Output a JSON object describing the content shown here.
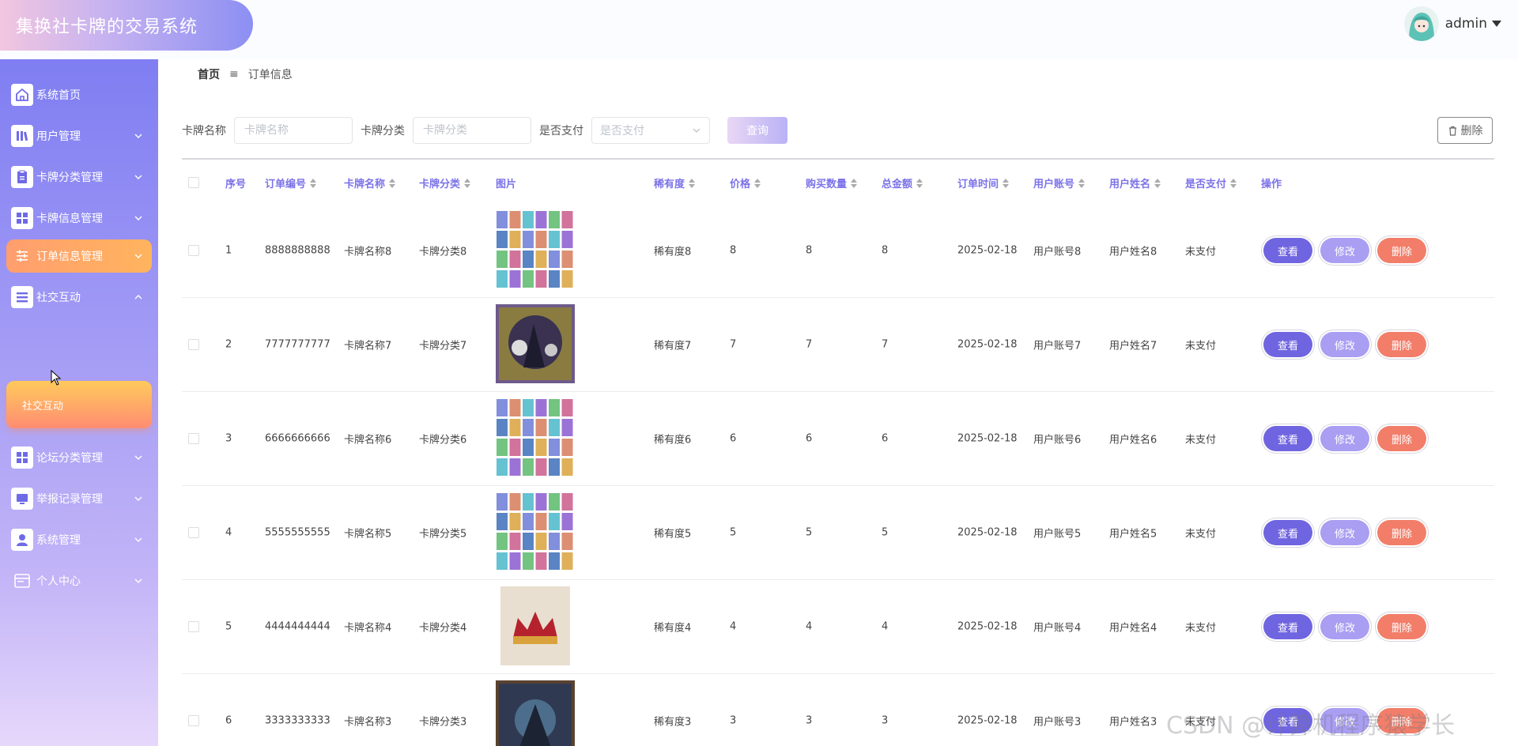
{
  "app": {
    "title": "集换社卡牌的交易系统"
  },
  "user": {
    "name": "admin"
  },
  "sidebar": {
    "items": [
      {
        "label": "系统首页",
        "icon": "home-icon",
        "has_children": false
      },
      {
        "label": "用户管理",
        "icon": "books-icon",
        "has_children": true
      },
      {
        "label": "卡牌分类管理",
        "icon": "clipboard-icon",
        "has_children": true
      },
      {
        "label": "卡牌信息管理",
        "icon": "grid-icon",
        "has_children": true
      },
      {
        "label": "订单信息管理",
        "icon": "sliders-icon",
        "has_children": true,
        "active": true
      },
      {
        "label": "社交互动",
        "icon": "list-icon",
        "has_children": true,
        "expanded": true
      },
      {
        "label": "论坛分类管理",
        "icon": "grid-icon",
        "has_children": true
      },
      {
        "label": "举报记录管理",
        "icon": "monitor-icon",
        "has_children": true
      },
      {
        "label": "系统管理",
        "icon": "person-icon",
        "has_children": true
      },
      {
        "label": "个人中心",
        "icon": "window-icon",
        "has_children": true
      }
    ],
    "submenu": {
      "label": "社交互动"
    }
  },
  "breadcrumb": {
    "home": "首页",
    "separator": "≡",
    "current": "订单信息"
  },
  "filters": {
    "card_name_label": "卡牌名称",
    "card_name_placeholder": "卡牌名称",
    "card_category_label": "卡牌分类",
    "card_category_placeholder": "卡牌分类",
    "paid_label": "是否支付",
    "paid_placeholder": "是否支付",
    "query_button": "查询"
  },
  "toolbar": {
    "delete_button": "删除"
  },
  "table": {
    "headers": [
      "序号",
      "订单编号",
      "卡牌名称",
      "卡牌分类",
      "图片",
      "稀有度",
      "价格",
      "购买数量",
      "总金额",
      "订单时间",
      "用户账号",
      "用户姓名",
      "是否支付",
      "操作"
    ],
    "actions": {
      "view": "查看",
      "edit": "修改",
      "delete": "删除"
    },
    "rows": [
      {
        "index": "1",
        "order_no": "8888888888",
        "card_name": "卡牌名称8",
        "category": "卡牌分类8",
        "image": "card-grid",
        "rarity": "稀有度8",
        "price": "8",
        "qty": "8",
        "total": "8",
        "date": "2025-02-18",
        "account": "用户账号8",
        "username": "用户姓名8",
        "paid": "未支付"
      },
      {
        "index": "2",
        "order_no": "7777777777",
        "card_name": "卡牌名称7",
        "category": "卡牌分类7",
        "image": "card-warrior",
        "rarity": "稀有度7",
        "price": "7",
        "qty": "7",
        "total": "7",
        "date": "2025-02-18",
        "account": "用户账号7",
        "username": "用户姓名7",
        "paid": "未支付"
      },
      {
        "index": "3",
        "order_no": "6666666666",
        "card_name": "卡牌名称6",
        "category": "卡牌分类6",
        "image": "card-grid",
        "rarity": "稀有度6",
        "price": "6",
        "qty": "6",
        "total": "6",
        "date": "2025-02-18",
        "account": "用户账号6",
        "username": "用户姓名6",
        "paid": "未支付"
      },
      {
        "index": "4",
        "order_no": "5555555555",
        "card_name": "卡牌名称5",
        "category": "卡牌分类5",
        "image": "card-grid",
        "rarity": "稀有度5",
        "price": "5",
        "qty": "5",
        "total": "5",
        "date": "2025-02-18",
        "account": "用户账号5",
        "username": "用户姓名5",
        "paid": "未支付"
      },
      {
        "index": "5",
        "order_no": "4444444444",
        "card_name": "卡牌名称4",
        "category": "卡牌分类4",
        "image": "card-crown",
        "rarity": "稀有度4",
        "price": "4",
        "qty": "4",
        "total": "4",
        "date": "2025-02-18",
        "account": "用户账号4",
        "username": "用户姓名4",
        "paid": "未支付"
      },
      {
        "index": "6",
        "order_no": "3333333333",
        "card_name": "卡牌名称3",
        "category": "卡牌分类3",
        "image": "card-dark",
        "rarity": "稀有度3",
        "price": "3",
        "qty": "3",
        "total": "3",
        "date": "2025-02-18",
        "account": "用户账号3",
        "username": "用户姓名3",
        "paid": "未支付"
      }
    ]
  },
  "watermark": "CSDN @计算机程序猿学长",
  "colors": {
    "accent": "#7b72e8",
    "active": "#ff9e6e",
    "delete": "#f27e6a"
  }
}
